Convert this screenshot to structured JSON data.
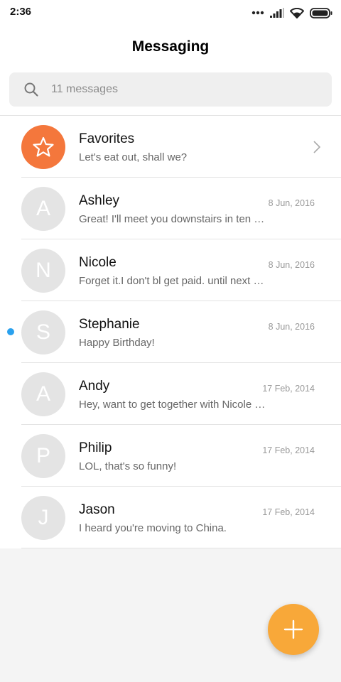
{
  "status_bar": {
    "time": "2:36",
    "icons": [
      "more-dots-icon",
      "signal-icon",
      "wifi-icon",
      "battery-icon"
    ]
  },
  "header": {
    "title": "Messaging"
  },
  "search": {
    "placeholder": "11 messages",
    "icon": "search-icon"
  },
  "favorites": {
    "name": "Favorites",
    "preview": "Let's eat out, shall we?",
    "icon": "star-icon",
    "color": "#f4773c"
  },
  "conversations": [
    {
      "initial": "A",
      "name": "Ashley",
      "preview": "Great! I'll meet you downstairs in ten …",
      "date": "8 Jun, 2016",
      "unread": false
    },
    {
      "initial": "N",
      "name": "Nicole",
      "preview": "Forget it.I don't bl get paid. until next …",
      "date": "8 Jun, 2016",
      "unread": false
    },
    {
      "initial": "S",
      "name": "Stephanie",
      "preview": "Happy Birthday!",
      "date": "8 Jun, 2016",
      "unread": true
    },
    {
      "initial": "A",
      "name": "Andy",
      "preview": "Hey, want to get together with Nicole …",
      "date": "17 Feb, 2014",
      "unread": false
    },
    {
      "initial": "P",
      "name": "Philip",
      "preview": "LOL, that's so funny!",
      "date": "17 Feb, 2014",
      "unread": false
    },
    {
      "initial": "J",
      "name": "Jason",
      "preview": "I heard you're moving to China.",
      "date": "17 Feb, 2014",
      "unread": false
    }
  ],
  "fab": {
    "icon": "plus-icon",
    "color": "#f8a839"
  },
  "colors": {
    "unread_dot": "#2aa1ee",
    "avatar_bg": "#e4e4e4"
  }
}
